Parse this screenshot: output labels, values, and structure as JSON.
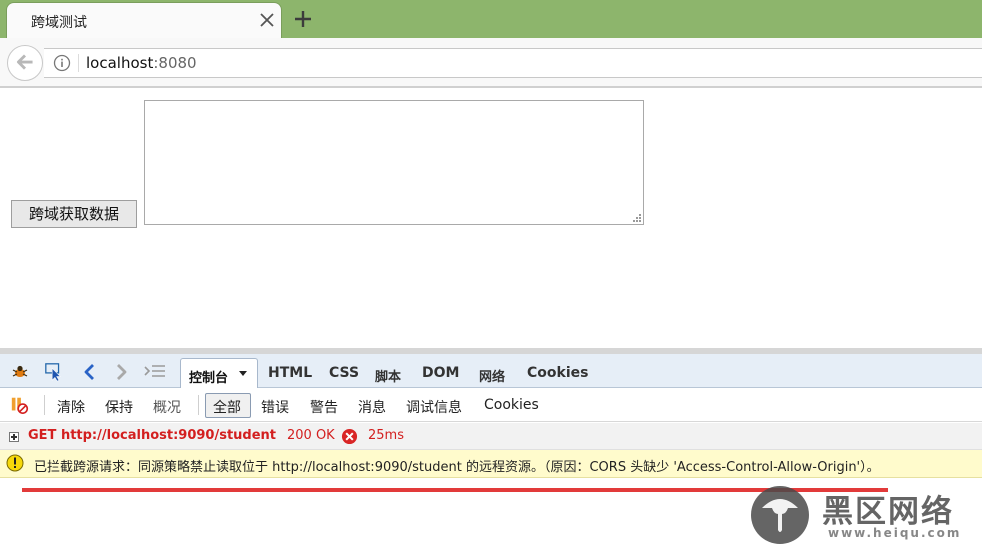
{
  "browser": {
    "tab_title": "跨域测试",
    "new_tab_symbol": "+",
    "url_host": "localhost",
    "url_port": ":8080"
  },
  "page": {
    "fetch_button_label": "跨域获取数据",
    "textarea_value": ""
  },
  "devtools": {
    "active_tab_label": "控制台",
    "tabs": [
      "HTML",
      "CSS",
      "脚本",
      "DOM",
      "网络",
      "Cookies"
    ],
    "actions": [
      "清除",
      "保持",
      "概况"
    ],
    "filters": [
      "全部",
      "错误",
      "警告",
      "消息",
      "调试信息",
      "Cookies"
    ],
    "request": {
      "method_url": "GET http://localhost:9090/student",
      "status": "200 OK",
      "time": "25ms"
    },
    "warning_message": "已拦截跨源请求：同源策略禁止读取位于 http://localhost:9090/student 的远程资源。（原因：CORS 头缺少 'Access-Control-Allow-Origin'）。",
    "colors": {
      "error": "#d31f1f",
      "warning_bg": "#fffbcc",
      "highlight": "#e23a3a"
    }
  },
  "watermark": {
    "title": "黑区网络",
    "url": "www.heiqu.com"
  }
}
